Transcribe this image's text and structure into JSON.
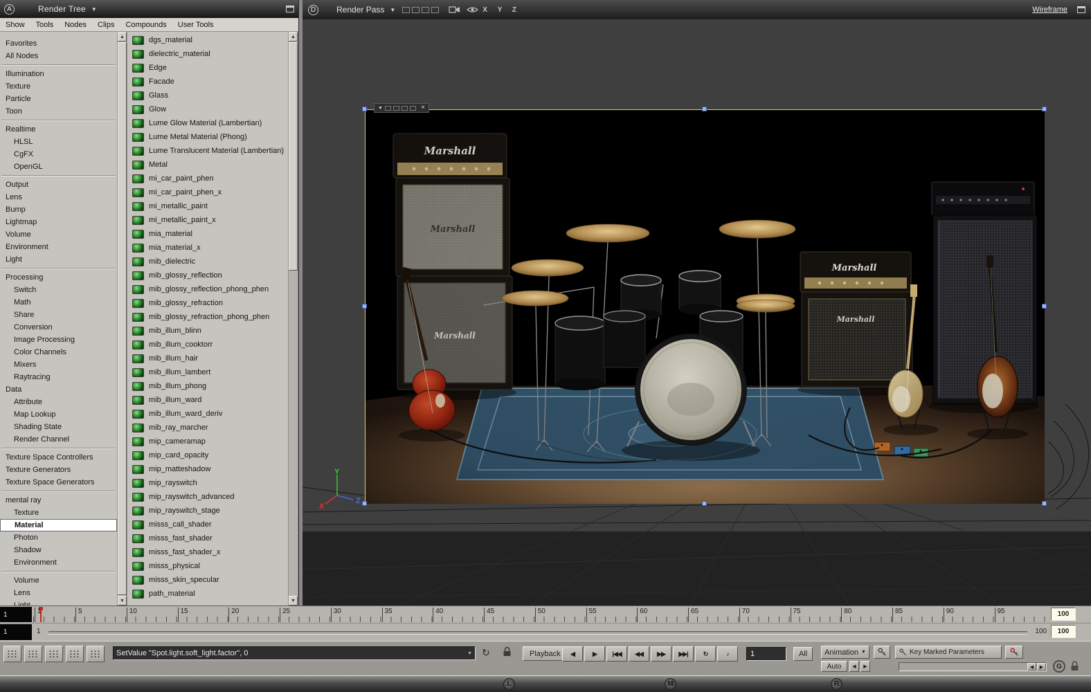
{
  "icons": {
    "dropdown": "▼",
    "close": "×",
    "scroll_up": "▲",
    "scroll_down": "▼",
    "loop": "↻",
    "audio": "♪"
  },
  "left_panel": {
    "window_letter": "A",
    "title": "Render Tree",
    "menus": [
      "Show",
      "Tools",
      "Nodes",
      "Clips",
      "Compounds",
      "User Tools"
    ],
    "categories": [
      {
        "label": "Favorites"
      },
      {
        "label": "All Nodes"
      },
      {
        "sep": true
      },
      {
        "label": "Illumination"
      },
      {
        "label": "Texture"
      },
      {
        "label": "Particle"
      },
      {
        "label": "Toon"
      },
      {
        "sep": true
      },
      {
        "label": "Realtime"
      },
      {
        "label": "HLSL",
        "indent": true
      },
      {
        "label": "CgFX",
        "indent": true
      },
      {
        "label": "OpenGL",
        "indent": true
      },
      {
        "sep": true
      },
      {
        "label": "Output"
      },
      {
        "label": "Lens"
      },
      {
        "label": "Bump"
      },
      {
        "label": "Lightmap"
      },
      {
        "label": "Volume"
      },
      {
        "label": "Environment"
      },
      {
        "label": "Light"
      },
      {
        "sep": true
      },
      {
        "label": "Processing"
      },
      {
        "label": "Switch",
        "indent": true
      },
      {
        "label": "Math",
        "indent": true
      },
      {
        "label": "Share",
        "indent": true
      },
      {
        "label": "Conversion",
        "indent": true
      },
      {
        "label": "Image Processing",
        "indent": true
      },
      {
        "label": "Color Channels",
        "indent": true
      },
      {
        "label": "Mixers",
        "indent": true
      },
      {
        "label": "Raytracing",
        "indent": true
      },
      {
        "label": "Data"
      },
      {
        "label": "Attribute",
        "indent": true
      },
      {
        "label": "Map Lookup",
        "indent": true
      },
      {
        "label": "Shading State",
        "indent": true
      },
      {
        "label": "Render Channel",
        "indent": true
      },
      {
        "sep": true
      },
      {
        "label": "Texture Space Controllers"
      },
      {
        "label": "Texture Generators"
      },
      {
        "label": "Texture Space Generators"
      },
      {
        "sep": true
      },
      {
        "label": "mental ray"
      },
      {
        "label": "Texture",
        "indent": true
      },
      {
        "label": "Material",
        "indent": true,
        "selected": true
      },
      {
        "label": "Photon",
        "indent": true
      },
      {
        "label": "Shadow",
        "indent": true
      },
      {
        "label": "Environment",
        "indent": true
      },
      {
        "sep": true
      },
      {
        "label": "Volume",
        "indent": true
      },
      {
        "label": "Lens",
        "indent": true
      },
      {
        "label": "Light",
        "indent": true
      }
    ],
    "nodes": [
      "dgs_material",
      "dielectric_material",
      "Edge",
      "Facade",
      "Glass",
      "Glow",
      "Lume Glow Material (Lambertian)",
      "Lume Metal Material (Phong)",
      "Lume Translucent Material (Lambertian)",
      "Metal",
      "mi_car_paint_phen",
      "mi_car_paint_phen_x",
      "mi_metallic_paint",
      "mi_metallic_paint_x",
      "mia_material",
      "mia_material_x",
      "mib_dielectric",
      "mib_glossy_reflection",
      "mib_glossy_reflection_phong_phen",
      "mib_glossy_refraction",
      "mib_glossy_refraction_phong_phen",
      "mib_illum_blinn",
      "mib_illum_cooktorr",
      "mib_illum_hair",
      "mib_illum_lambert",
      "mib_illum_phong",
      "mib_illum_ward",
      "mib_illum_ward_deriv",
      "mib_ray_marcher",
      "mip_cameramap",
      "mip_card_opacity",
      "mip_matteshadow",
      "mip_rayswitch",
      "mip_rayswitch_advanced",
      "mip_rayswitch_stage",
      "misss_call_shader",
      "misss_fast_shader",
      "misss_fast_shader_x",
      "misss_physical",
      "misss_skin_specular",
      "path_material"
    ]
  },
  "viewport": {
    "window_letter": "D",
    "title": "Render Pass",
    "axis_x": "X",
    "axis_y": "Y",
    "axis_z": "Z",
    "shading_mode": "Wireframe",
    "scene": {
      "amp_brand": "Marshall"
    }
  },
  "timeline": {
    "tick_labels": [
      1,
      5,
      10,
      15,
      20,
      25,
      30,
      35,
      40,
      45,
      50,
      55,
      60,
      65,
      70,
      75,
      80,
      85,
      90,
      95
    ],
    "current_frame": "1",
    "end_frame": "100",
    "range_start": "1",
    "range_end": "100",
    "range_end_box": "100"
  },
  "toolbar": {
    "command_value": "SetValue \"Spot.light.soft_light.factor\", 0",
    "playback_label": "Playback",
    "transport": [
      {
        "name": "frame-step-back",
        "glyph": "◀"
      },
      {
        "name": "frame-step-forward",
        "glyph": "▶"
      },
      {
        "name": "go-to-start",
        "glyph": "|◀◀"
      },
      {
        "name": "play-backward",
        "glyph": "◀◀"
      },
      {
        "name": "play-forward",
        "glyph": "▶▶"
      },
      {
        "name": "go-to-end",
        "glyph": "▶▶|"
      },
      {
        "name": "loop",
        "glyph": "↻"
      },
      {
        "name": "audio-mute",
        "glyph": "♪"
      }
    ],
    "frame_value": "1",
    "all_label": "All",
    "animation_label": "Animation",
    "auto_label": "Auto",
    "key_marked_label": "Key Marked Parameters",
    "g_label": "G"
  },
  "mouse_bar": {
    "left": "L",
    "middle": "M",
    "right": "R"
  }
}
